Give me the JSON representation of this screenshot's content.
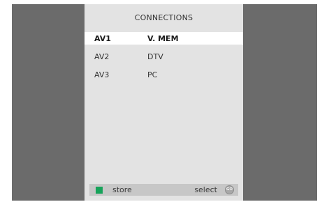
{
  "menu": {
    "title": "CONNECTIONS",
    "rows": [
      {
        "source": "AV1",
        "value": "V. MEM",
        "selected": true
      },
      {
        "source": "AV2",
        "value": "DTV",
        "selected": false
      },
      {
        "source": "AV3",
        "value": "PC",
        "selected": false
      }
    ]
  },
  "footer": {
    "green_key_color": "#17a35a",
    "store_label": "store",
    "select_label": "select",
    "go_icon": "go-button-icon",
    "go_text": "GO"
  },
  "colors": {
    "background": "#6b6b6b",
    "panel": "#e3e3e3",
    "highlight": "#ffffff",
    "footer_bar": "#c7c7c7"
  }
}
